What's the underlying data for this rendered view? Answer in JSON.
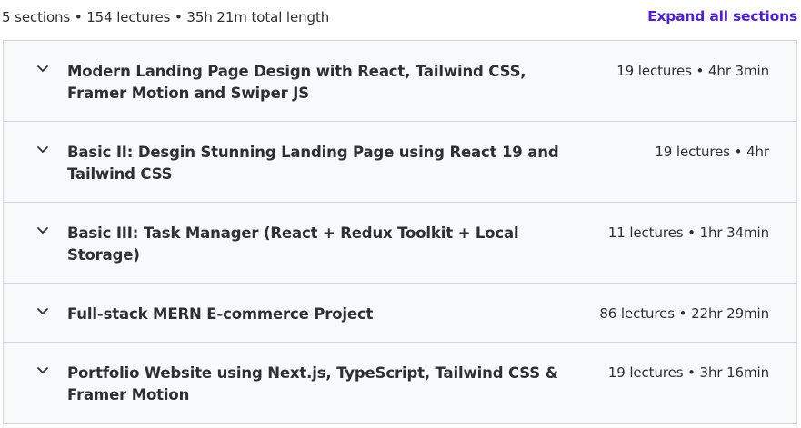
{
  "summary": {
    "text": "5 sections • 154 lectures • 35h 21m total length",
    "expand_label": "Expand all sections"
  },
  "colors": {
    "accent": "#5022c3",
    "section_bg": "#f7f9fa",
    "border": "#d1d7dc",
    "text": "#2d2f31"
  },
  "sections": [
    {
      "title": "Modern Landing Page Design with React, Tailwind CSS, Framer Motion and Swiper JS",
      "meta": "19 lectures • 4hr 3min",
      "icon": "chevron-down-icon"
    },
    {
      "title": "Basic II: Desgin Stunning Landing Page using React 19 and Tailwind CSS",
      "meta": "19 lectures • 4hr",
      "icon": "chevron-down-icon"
    },
    {
      "title": "Basic III: Task Manager (React + Redux Toolkit + Local Storage)",
      "meta": "11 lectures • 1hr 34min",
      "icon": "chevron-down-icon"
    },
    {
      "title": "Full-stack MERN E-commerce Project",
      "meta": "86 lectures • 22hr 29min",
      "icon": "chevron-down-icon"
    },
    {
      "title": "Portfolio Website using Next.js, TypeScript, Tailwind CSS & Framer Motion",
      "meta": "19 lectures • 3hr 16min",
      "icon": "chevron-down-icon"
    }
  ]
}
